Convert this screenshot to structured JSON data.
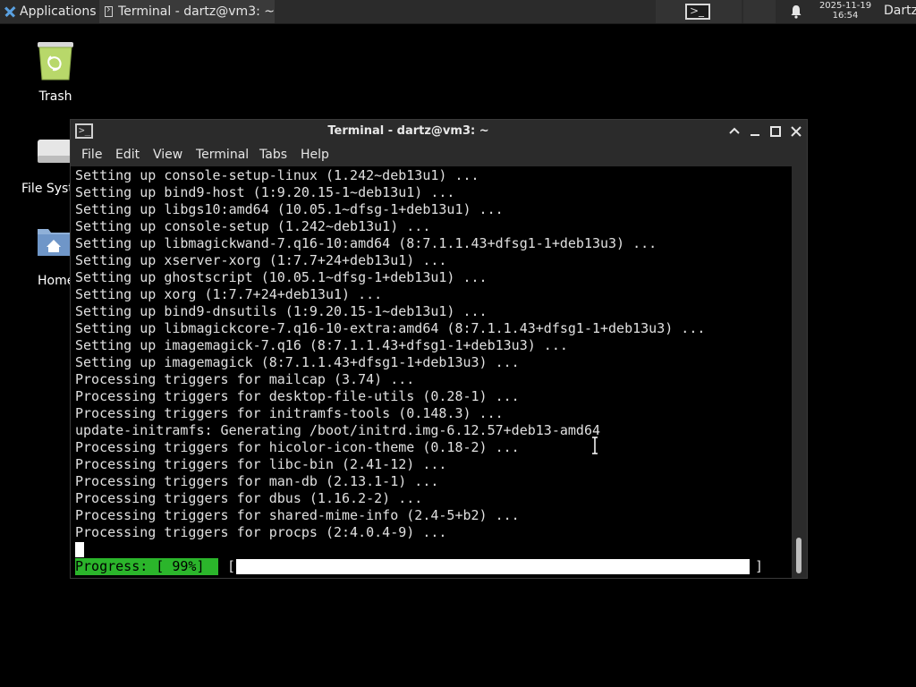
{
  "panel": {
    "applications_label": "Applications",
    "task_label": "Terminal - dartz@vm3: ~",
    "clock_date": "2025-11-19",
    "clock_time": "16:54",
    "user_label": "Dartz"
  },
  "desktop": {
    "trash_label": "Trash",
    "filesystem_label": "File System",
    "home_label": "Home"
  },
  "window": {
    "title": "Terminal - dartz@vm3: ~",
    "menu": [
      "File",
      "Edit",
      "View",
      "Terminal",
      "Tabs",
      "Help"
    ]
  },
  "terminal": {
    "lines": [
      "Setting up console-setup-linux (1.242~deb13u1) ...",
      "Setting up bind9-host (1:9.20.15-1~deb13u1) ...",
      "Setting up libgs10:amd64 (10.05.1~dfsg-1+deb13u1) ...",
      "Setting up console-setup (1.242~deb13u1) ...",
      "Setting up libmagickwand-7.q16-10:amd64 (8:7.1.1.43+dfsg1-1+deb13u3) ...",
      "Setting up xserver-xorg (1:7.7+24+deb13u1) ...",
      "Setting up ghostscript (10.05.1~dfsg-1+deb13u1) ...",
      "Setting up xorg (1:7.7+24+deb13u1) ...",
      "Setting up bind9-dnsutils (1:9.20.15-1~deb13u1) ...",
      "Setting up libmagickcore-7.q16-10-extra:amd64 (8:7.1.1.43+dfsg1-1+deb13u3) ...",
      "Setting up imagemagick-7.q16 (8:7.1.1.43+dfsg1-1+deb13u3) ...",
      "Setting up imagemagick (8:7.1.1.43+dfsg1-1+deb13u3) ...",
      "Processing triggers for mailcap (3.74) ...",
      "Processing triggers for desktop-file-utils (0.28-1) ...",
      "Processing triggers for initramfs-tools (0.148.3) ...",
      "update-initramfs: Generating /boot/initrd.img-6.12.57+deb13-amd64",
      "Processing triggers for hicolor-icon-theme (0.18-2) ...",
      "Processing triggers for libc-bin (2.41-12) ...",
      "Processing triggers for man-db (2.13.1-1) ...",
      "Processing triggers for dbus (1.16.2-2) ...",
      "Processing triggers for shared-mime-info (2.4-5+b2) ...",
      "Processing triggers for procps (2:4.0.4-9) ..."
    ],
    "progress_label": "Progress: [ 99%]",
    "progress_open": "[",
    "progress_close": "]",
    "progress_value": 0.99
  },
  "colors": {
    "progress_green": "#2bb52b",
    "panel_bg": "#2b2b2b",
    "terminal_bg": "#000000"
  }
}
